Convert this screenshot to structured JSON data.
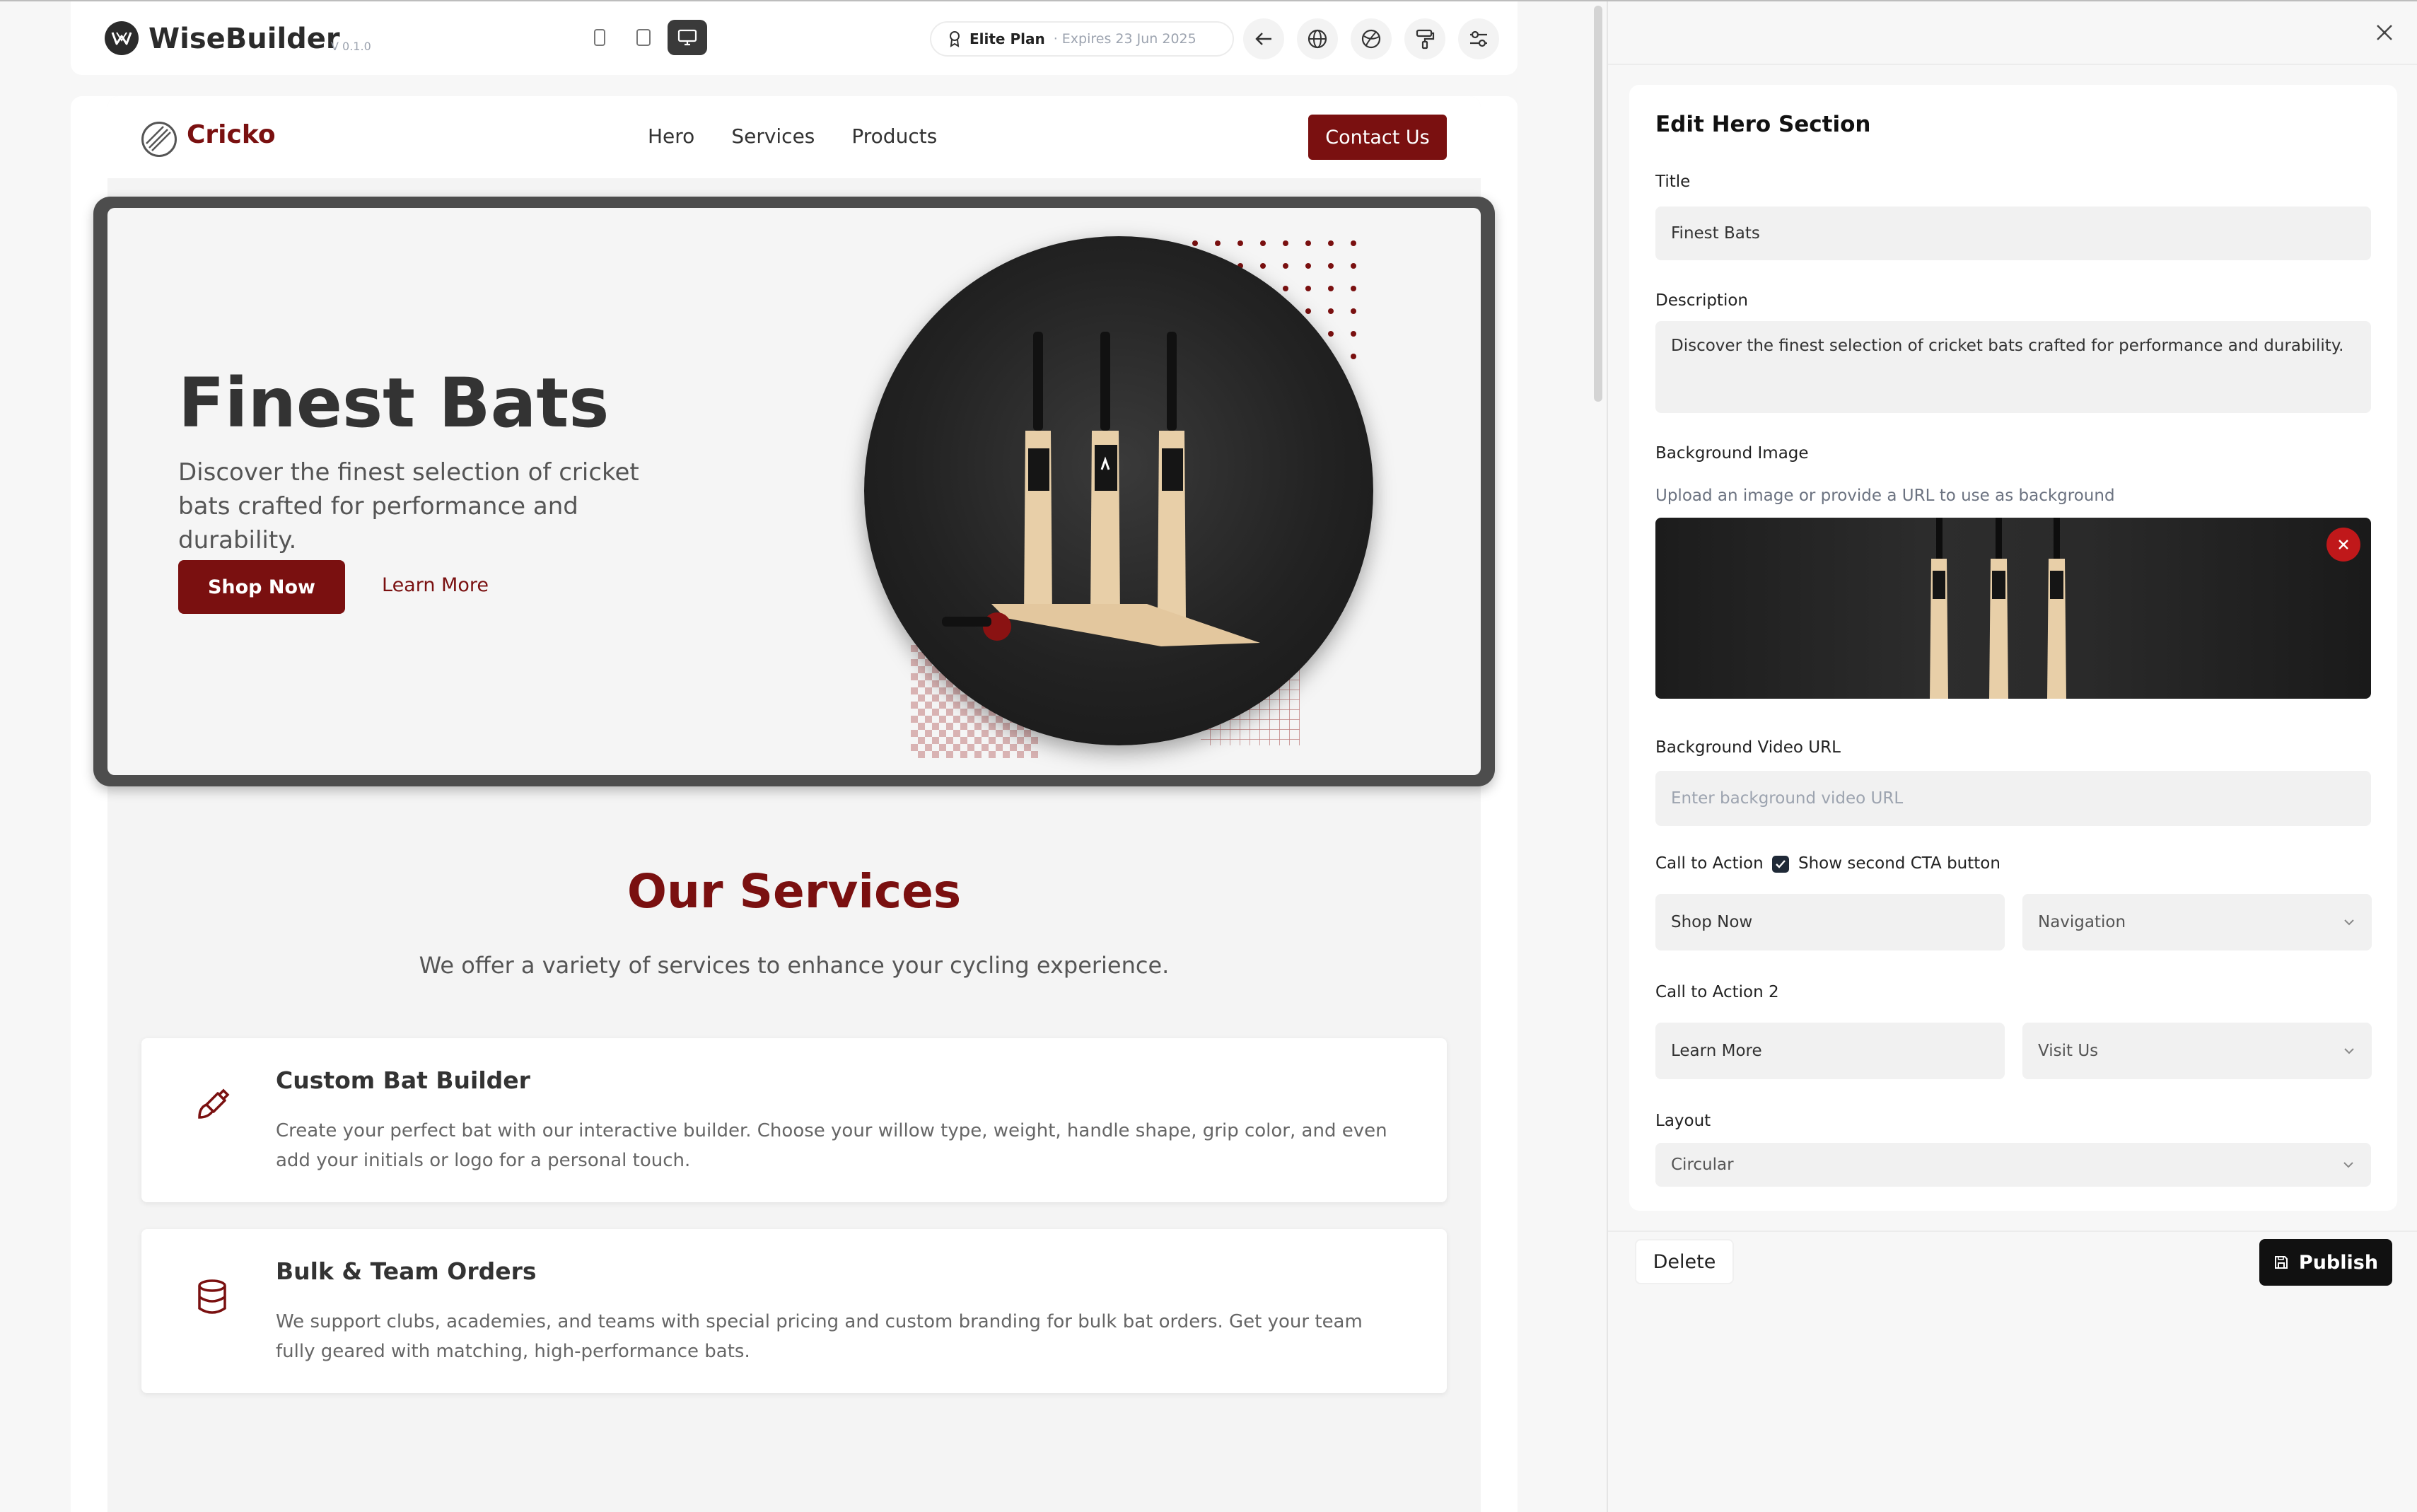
{
  "app": {
    "name": "WiseBuilder",
    "version": "V 0.1.0",
    "plan_name": "Elite Plan",
    "plan_expiry": "· Expires 23 Jun 2025",
    "device_modes": [
      "mobile",
      "tablet",
      "desktop"
    ],
    "active_device": "desktop",
    "toolbar_icons": [
      "back-arrow-icon",
      "globe-icon",
      "palette-icon",
      "paint-roller-icon",
      "settings-sliders-icon"
    ]
  },
  "site": {
    "brand": "Cricko",
    "nav": [
      "Hero",
      "Services",
      "Products"
    ],
    "contact_label": "Contact Us",
    "accent": "#7a1010",
    "hero": {
      "title": "Finest Bats",
      "description": "Discover the finest selection of cricket bats crafted for performance and durability.",
      "cta_primary": "Shop Now",
      "cta_secondary": "Learn More"
    },
    "services": {
      "title": "Our Services",
      "subtitle": "We offer a variety of services to enhance your cycling experience.",
      "items": [
        {
          "title": "Custom Bat Builder",
          "description": "Create your perfect bat with our interactive builder. Choose your willow type, weight, handle shape, grip color, and even add your initials or logo for a personal touch.",
          "icon": "paintbrush-icon"
        },
        {
          "title": "Bulk & Team Orders",
          "description": "We support clubs, academies, and teams with special pricing and custom branding for bulk bat orders. Get your team fully geared with matching, high-performance bats.",
          "icon": "database-icon"
        }
      ]
    }
  },
  "panel": {
    "title": "Edit Hero Section",
    "title_label": "Title",
    "title_value": "Finest Bats",
    "description_label": "Description",
    "description_value": "Discover the finest selection of cricket bats crafted for performance and durability.",
    "bg_image_label": "Background Image",
    "bg_image_help": "Upload an image or provide a URL to use as background",
    "bg_video_label": "Background Video URL",
    "bg_video_placeholder": "Enter background video URL",
    "cta_label": "Call to Action",
    "second_cta_checkbox": "Show second CTA button",
    "cta1_text": "Shop Now",
    "cta1_link": "Navigation",
    "cta2_label": "Call to Action 2",
    "cta2_text": "Learn More",
    "cta2_link": "Visit Us",
    "layout_label": "Layout",
    "layout_value": "Circular",
    "delete_label": "Delete",
    "publish_label": "Publish"
  }
}
